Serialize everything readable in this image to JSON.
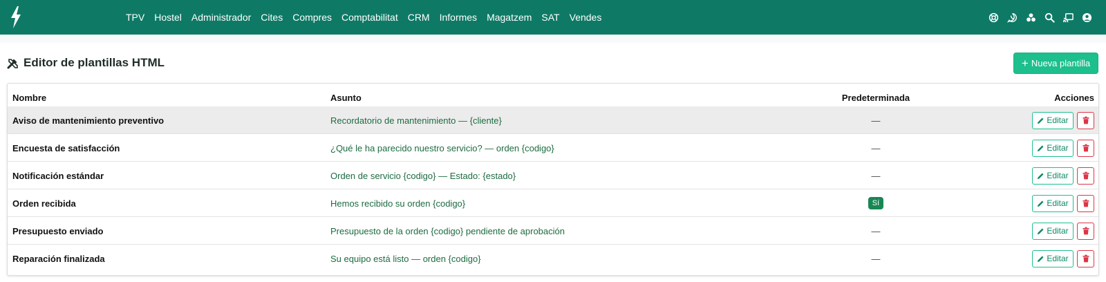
{
  "navbar": {
    "logo_icon": "bolt-icon",
    "menu": [
      "TPV",
      "Hostel",
      "Administrador",
      "Cites",
      "Compres",
      "Comptabilitat",
      "CRM",
      "Informes",
      "Magatzem",
      "SAT",
      "Vendes"
    ],
    "right_icons": [
      "lifebuoy-icon",
      "whatsapp-icon",
      "apps-icon",
      "search-icon",
      "cast-icon",
      "user-icon"
    ]
  },
  "page": {
    "title": "Editor de plantillas HTML",
    "title_icon": "tools-icon",
    "new_button": "Nueva plantilla"
  },
  "table": {
    "headers": {
      "name": "Nombre",
      "subject": "Asunto",
      "default": "Predeterminada",
      "actions": "Acciones"
    },
    "rows": [
      {
        "name": "Aviso de mantenimiento preventivo",
        "subject": "Recordatorio de mantenimiento — {cliente}",
        "default": "—",
        "is_default": false
      },
      {
        "name": "Encuesta de satisfacción",
        "subject": "¿Qué le ha parecido nuestro servicio? — orden {codigo}",
        "default": "—",
        "is_default": false
      },
      {
        "name": "Notificación estándar",
        "subject": "Orden de servicio {codigo} — Estado: {estado}",
        "default": "—",
        "is_default": false
      },
      {
        "name": "Orden recibida",
        "subject": "Hemos recibido su orden {codigo}",
        "default": "Sí",
        "is_default": true
      },
      {
        "name": "Presupuesto enviado",
        "subject": "Presupuesto de la orden {codigo} pendiente de aprobación",
        "default": "—",
        "is_default": false
      },
      {
        "name": "Reparación finalizada",
        "subject": "Su equipo está listo — orden {codigo}",
        "default": "—",
        "is_default": false
      }
    ],
    "edit_label": "Editar"
  },
  "colors": {
    "navbar": "#0e7a66",
    "primary_button": "#1dbf8d",
    "subject_text": "#1d6b40",
    "badge": "#198754",
    "danger": "#dc3545"
  }
}
